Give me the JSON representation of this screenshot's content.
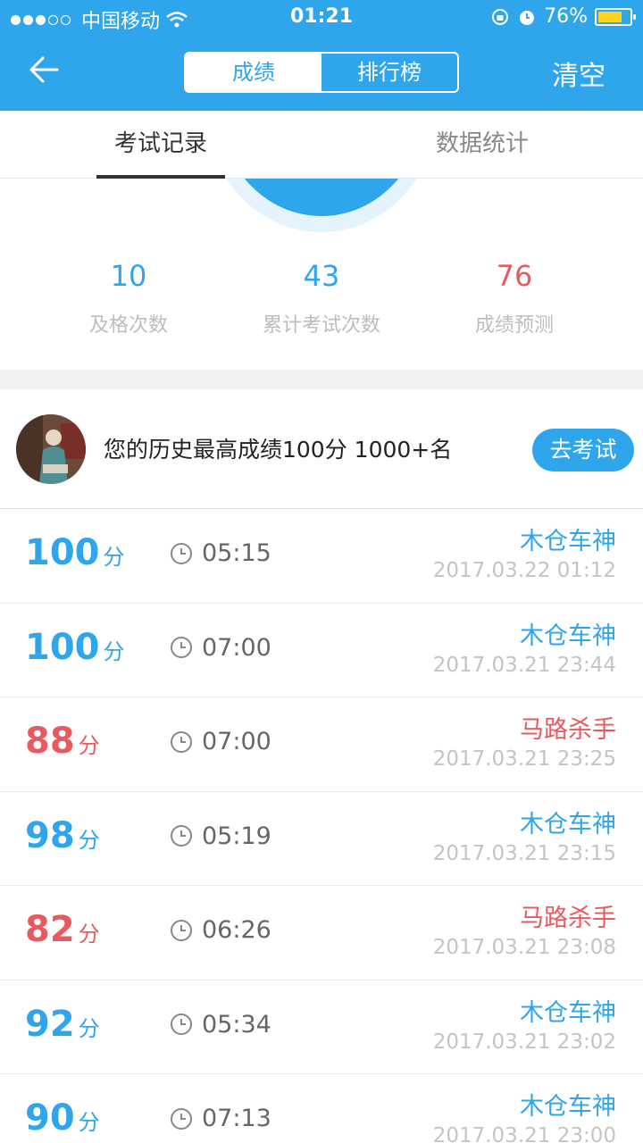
{
  "status_bar": {
    "carrier": "中国移动",
    "time": "01:21",
    "battery": "76%",
    "battery_level": 0.76
  },
  "nav": {
    "segments": [
      "成绩",
      "排行榜"
    ],
    "active_segment": "成绩",
    "clear_label": "清空"
  },
  "tabs": [
    "考试记录",
    "数据统计"
  ],
  "stats": [
    {
      "value": "10",
      "label": "及格次数",
      "color": "#2fa6ec"
    },
    {
      "value": "43",
      "label": "累计考试次数",
      "color": "#2fa6ec"
    },
    {
      "value": "76",
      "label": "成绩预测",
      "color": "#e85a5f"
    }
  ],
  "best": {
    "text": "您的历史最高成绩100分 1000+名",
    "button": "去考试"
  },
  "records": [
    {
      "score": "100",
      "unit": "分",
      "duration": "05:15",
      "title": "木仓车神",
      "date": "2017.03.22 01:12",
      "color": "#2fa6ec"
    },
    {
      "score": "100",
      "unit": "分",
      "duration": "07:00",
      "title": "木仓车神",
      "date": "2017.03.21 23:44",
      "color": "#2fa6ec"
    },
    {
      "score": "88",
      "unit": "分",
      "duration": "07:00",
      "title": "马路杀手",
      "date": "2017.03.21 23:25",
      "color": "#e85a5f"
    },
    {
      "score": "98",
      "unit": "分",
      "duration": "05:19",
      "title": "木仓车神",
      "date": "2017.03.21 23:15",
      "color": "#2fa6ec"
    },
    {
      "score": "82",
      "unit": "分",
      "duration": "06:26",
      "title": "马路杀手",
      "date": "2017.03.21 23:08",
      "color": "#e85a5f"
    },
    {
      "score": "92",
      "unit": "分",
      "duration": "05:34",
      "title": "木仓车神",
      "date": "2017.03.21 23:02",
      "color": "#2fa6ec"
    },
    {
      "score": "90",
      "unit": "分",
      "duration": "07:13",
      "title": "木仓车神",
      "date": "2017.03.21 23:00",
      "color": "#2fa6ec"
    }
  ]
}
